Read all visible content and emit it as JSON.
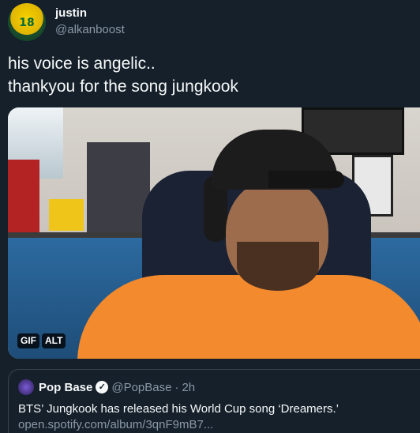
{
  "author": {
    "display_name": "justin",
    "handle": "@alkanboost",
    "avatar_number": "18"
  },
  "tweet": {
    "lines": [
      "his voice is angelic..",
      "thankyou for the song jungkook"
    ]
  },
  "media": {
    "badges": [
      "GIF",
      "ALT"
    ]
  },
  "quoted_tweet": {
    "display_name": "Pop Base",
    "handle": "@PopBase",
    "separator": "·",
    "time": "2h",
    "verified_glyph": "✓",
    "text": "BTS’ Jungkook has released his World Cup song ‘Dreamers.’",
    "link": "open.spotify.com/album/3qnF9mB7..."
  },
  "colors": {
    "background": "#15202b",
    "text": "#f7f9f9",
    "muted": "#8b98a5",
    "border": "#38444d"
  },
  "icons": {
    "verified": "verified-badge-icon",
    "avatar": "avatar-icon"
  }
}
